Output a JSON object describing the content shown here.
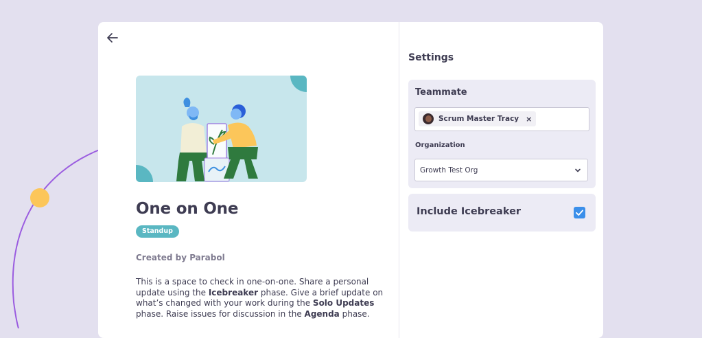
{
  "template": {
    "title": "One on One",
    "badge": "Standup",
    "created_by": "Created by Parabol",
    "description": {
      "part1": "This is a space to check in one-on-one. Share a personal update using the ",
      "icebreaker": "Icebreaker",
      "part2": " phase. Give a brief update on what’s changed with your work during the ",
      "solo_updates": "Solo Updates",
      "part3": " phase. Raise issues for discussion in the ",
      "agenda": "Agenda",
      "part4": " phase."
    }
  },
  "settings": {
    "heading": "Settings",
    "teammate": {
      "label": "Teammate",
      "selected": "Scrum Master Tracy",
      "remove_icon": "×"
    },
    "organization": {
      "label": "Organization",
      "value": "Growth Test Org"
    },
    "icebreaker": {
      "label": "Include Icebreaker",
      "checked": true
    }
  },
  "colors": {
    "background": "#E3E0EF",
    "accent_purple": "#9B5DE0",
    "accent_yellow": "#FCC65A",
    "badge_teal": "#5AB7C2",
    "checkbox_blue": "#3B8FEA"
  },
  "icons": {
    "back": "arrow-left-icon",
    "chevron": "chevron-down-icon",
    "check": "check-icon"
  }
}
